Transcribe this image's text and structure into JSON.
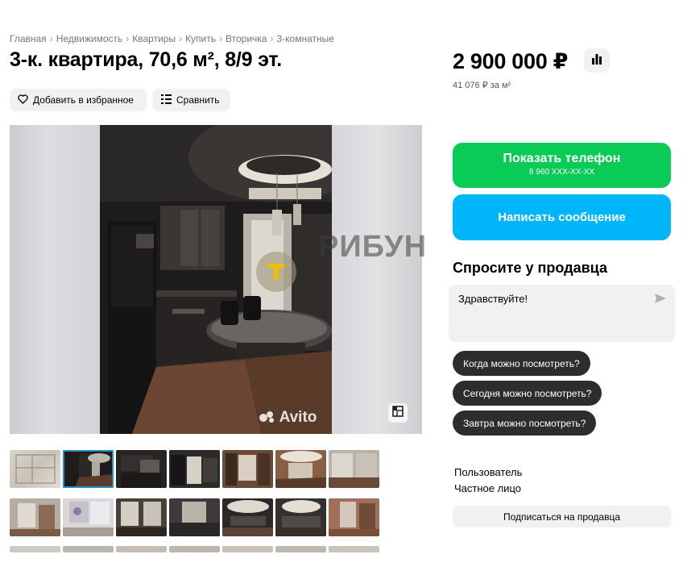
{
  "breadcrumb": [
    "Главная",
    "Недвижимость",
    "Квартиры",
    "Купить",
    "Вторичка",
    "3-комнатные"
  ],
  "breadcrumb_separator": "›",
  "listing": {
    "title": "3-к. квартира, 70,6 м², 8/9 эт.",
    "favorite_label": "Добавить в избранное",
    "compare_label": "Сравнить"
  },
  "price": {
    "value": "2 900 000 ₽",
    "per_m2": "41 076 ₽ за м²"
  },
  "gallery": {
    "watermark_text": "РИБУН",
    "avito_mark": "Avito",
    "thumbnails_total": 21,
    "selected_index": 1
  },
  "contact": {
    "phone_label": "Показать телефон",
    "phone_masked": "8 960 XXX-XX-XX",
    "message_label": "Написать сообщение"
  },
  "ask": {
    "title": "Спросите у продавца",
    "input_value": "Здравствуйте!",
    "quick_questions": [
      "Когда можно посмотреть?",
      "Сегодня можно посмотреть?",
      "Завтра можно посмотреть?"
    ]
  },
  "seller": {
    "type_label": "Пользователь",
    "kind_label": "Частное лицо",
    "subscribe_label": "Подписаться на продавца"
  },
  "colors": {
    "phone_button": "#0acb55",
    "message_button": "#01b5f9",
    "chip": "#2d2d2d",
    "secondary_button": "#f2f1f0",
    "selected_thumb_outline": "#2b8ac9"
  },
  "icons": {
    "favorite": "heart-icon",
    "compare": "compare-icon",
    "price_history": "bar-chart-icon",
    "send": "send-icon",
    "fullscreen": "fullscreen-icon"
  }
}
